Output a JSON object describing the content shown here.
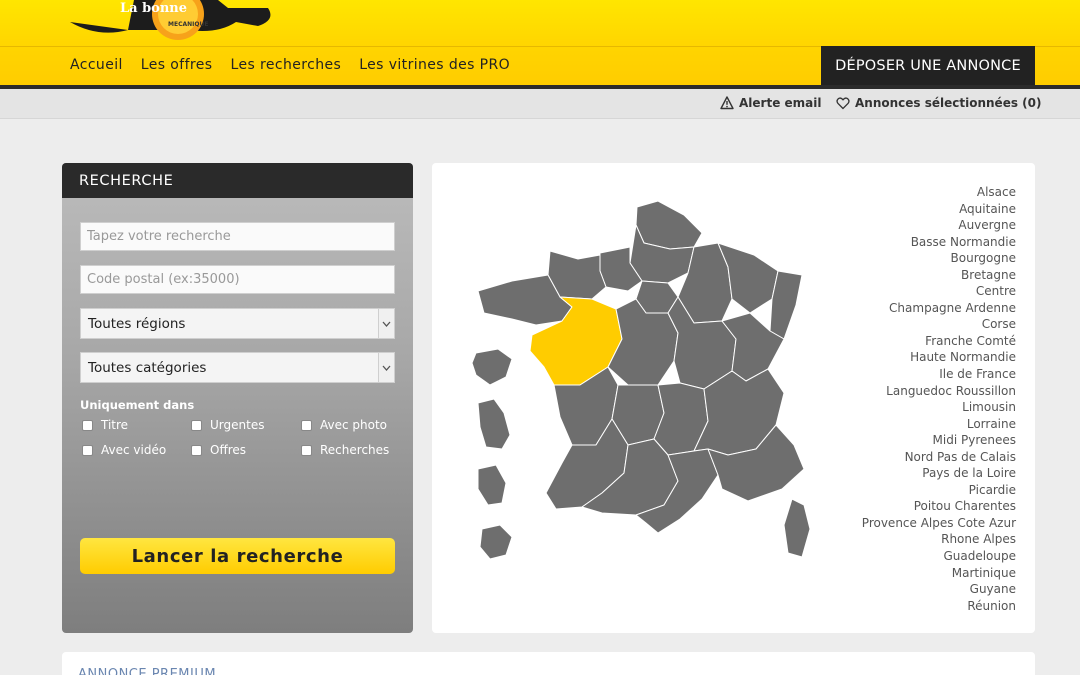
{
  "header": {
    "logo_text": "La bonne",
    "logo_sub": "MECANIQUE",
    "nav": [
      "Accueil",
      "Les offres",
      "Les recherches",
      "Les vitrines des PRO"
    ],
    "deposit_label": "DÉPOSER UNE ANNONCE"
  },
  "subbar": {
    "alert_label": "Alerte email",
    "selected_label": "Annonces sélectionnées (0)"
  },
  "search": {
    "title": "RECHERCHE",
    "query_placeholder": "Tapez votre recherche",
    "postal_placeholder": "Code postal (ex:35000)",
    "region_select": "Toutes régions",
    "category_select": "Toutes catégories",
    "only_in": "Uniquement dans",
    "checkboxes": [
      "Titre",
      "Urgentes",
      "Avec photo",
      "Avec vidéo",
      "Offres",
      "Recherches"
    ],
    "launch_label": "Lancer la recherche"
  },
  "map": {
    "highlight_color": "#ffcc00",
    "region_color": "#6e6e6e",
    "regions": [
      "Alsace",
      "Aquitaine",
      "Auvergne",
      "Basse Normandie",
      "Bourgogne",
      "Bretagne",
      "Centre",
      "Champagne Ardenne",
      "Corse",
      "Franche Comté",
      "Haute Normandie",
      "Ile de France",
      "Languedoc Roussillon",
      "Limousin",
      "Lorraine",
      "Midi Pyrenees",
      "Nord Pas de Calais",
      "Pays de la Loire",
      "Picardie",
      "Poitou Charentes",
      "Provence Alpes Cote Azur",
      "Rhone Alpes",
      "Guadeloupe",
      "Martinique",
      "Guyane",
      "Réunion"
    ]
  },
  "premium": {
    "title": "ANNONCE PREMIUM"
  }
}
